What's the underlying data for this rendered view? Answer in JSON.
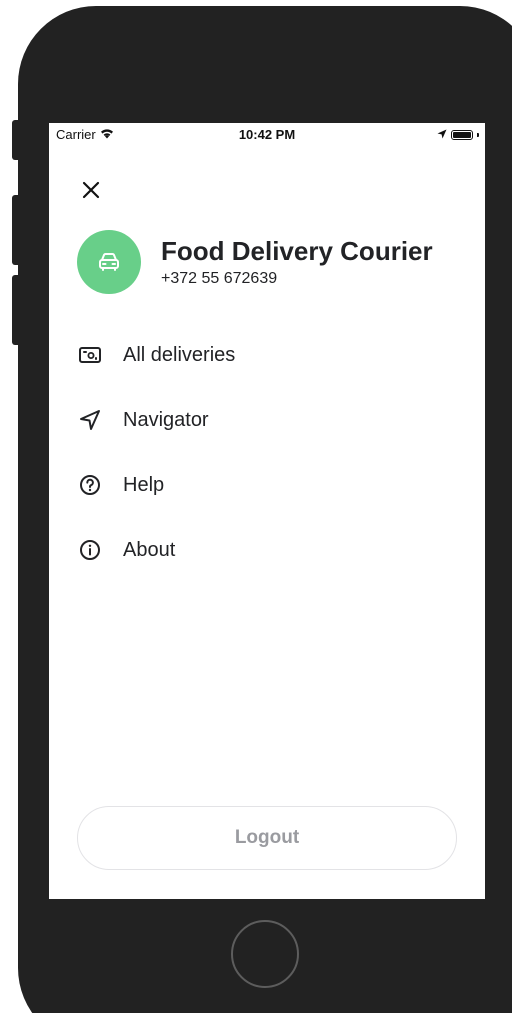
{
  "status_bar": {
    "carrier": "Carrier",
    "time": "10:42 PM"
  },
  "profile": {
    "name": "Food Delivery Courier",
    "phone": "+372 55 672639",
    "avatar_color": "#68cf89"
  },
  "menu": {
    "items": [
      {
        "label": "All deliveries",
        "icon": "deliveries-icon"
      },
      {
        "label": "Navigator",
        "icon": "navigation-arrow-icon"
      },
      {
        "label": "Help",
        "icon": "question-circle-icon"
      },
      {
        "label": "About",
        "icon": "info-circle-icon"
      }
    ]
  },
  "logout": {
    "label": "Logout"
  },
  "colors": {
    "text": "#222326",
    "accent": "#68cf89",
    "muted": "#9a9ba0",
    "phone_frame": "#222222"
  }
}
